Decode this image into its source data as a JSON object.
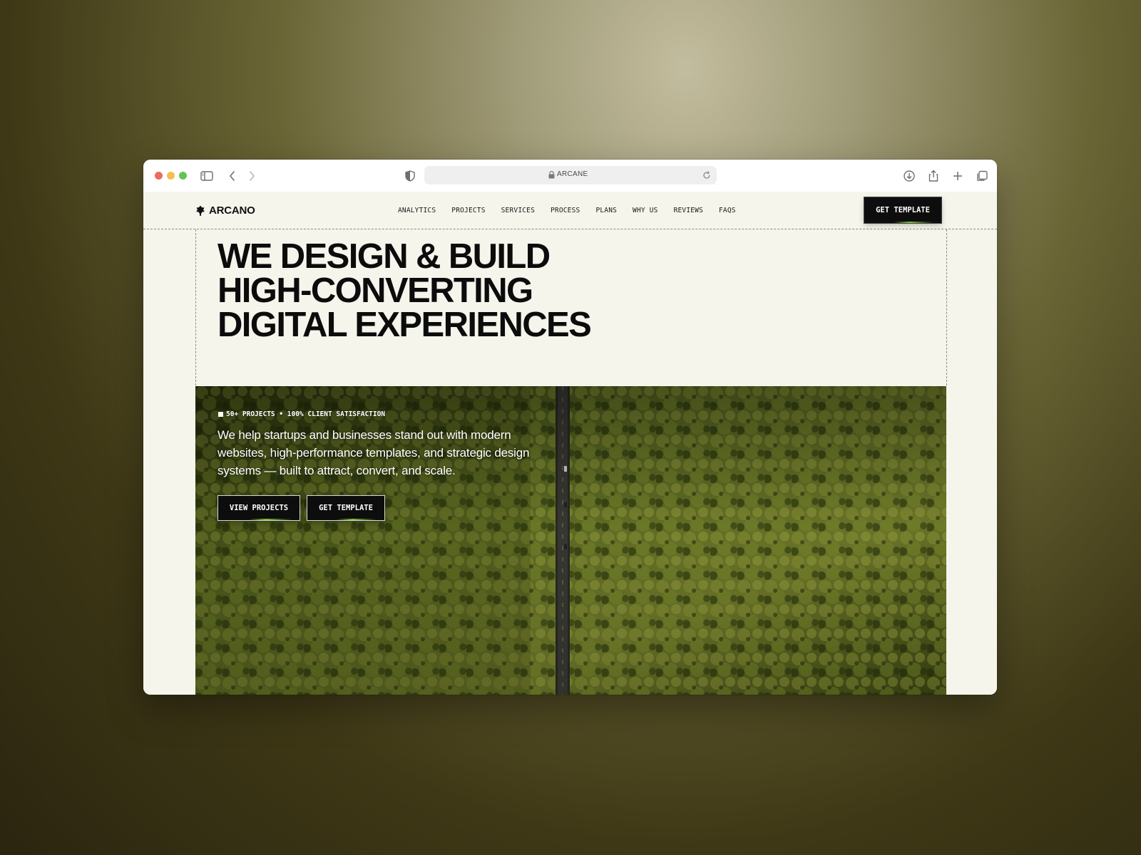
{
  "browser": {
    "url": "ARCANE",
    "icons": [
      "sidebar-icon",
      "back-icon",
      "forward-icon",
      "shield-icon",
      "lock-icon",
      "reload-icon",
      "download-icon",
      "share-icon",
      "new-tab-icon",
      "tabs-overview-icon"
    ]
  },
  "site": {
    "brand": "ARCANO",
    "nav": [
      "ANALYTICS",
      "PROJECTS",
      "SERVICES",
      "PROCESS",
      "PLANS",
      "WHY US",
      "REVIEWS",
      "FAQS"
    ],
    "nav_cta": "GET TEMPLATE",
    "headline": [
      "WE DESIGN & BUILD",
      "HIGH-CONVERTING",
      "DIGITAL EXPERIENCES"
    ],
    "badge": "50+ PROJECTS • 100% CLIENT SATISFACTION",
    "lead": "We help startups and businesses stand out with modern websites, high-performance templates, and strategic design systems — built to attract, convert, and scale.",
    "buttons": {
      "view": "VIEW PROJECTS",
      "get": "GET TEMPLATE"
    },
    "accent": "#7bc43c",
    "background": "#f6f5ec"
  }
}
